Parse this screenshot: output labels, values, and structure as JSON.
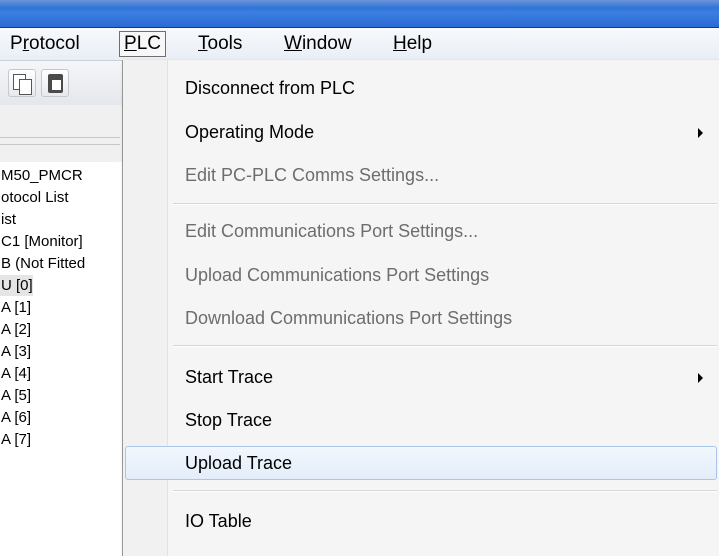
{
  "menubar": {
    "items": [
      {
        "label": "Protocol",
        "key": "r"
      },
      {
        "label": "PLC",
        "key": "P"
      },
      {
        "label": "Tools",
        "key": "T"
      },
      {
        "label": "Window",
        "key": "W"
      },
      {
        "label": "Help",
        "key": "H"
      }
    ]
  },
  "toolbar": {
    "buttons": [
      "copy-icon",
      "paste-icon"
    ]
  },
  "tree": {
    "items": [
      "M50_PMCR",
      "otocol List",
      "ist",
      "C1 [Monitor]",
      "B (Not Fitted",
      "U [0]",
      "A [1]",
      "A [2]",
      "A [3]",
      "A [4]",
      "A [5]",
      "A [6]",
      "A [7]"
    ]
  },
  "plc_menu": {
    "items": [
      {
        "label": "Disconnect from PLC",
        "enabled": true
      },
      {
        "label": "Operating Mode",
        "enabled": true,
        "submenu": true
      },
      {
        "label": "Edit PC-PLC Comms Settings...",
        "enabled": false
      },
      {
        "label": "Edit Communications Port Settings...",
        "enabled": false
      },
      {
        "label": "Upload Communications Port Settings",
        "enabled": false
      },
      {
        "label": "Download Communications Port Settings",
        "enabled": false
      },
      {
        "label": "Start Trace",
        "enabled": true,
        "submenu": true
      },
      {
        "label": "Stop Trace",
        "enabled": true
      },
      {
        "label": "Upload Trace",
        "enabled": true,
        "highlighted": true
      },
      {
        "label": "IO Table",
        "enabled": true
      }
    ]
  },
  "colors": {
    "titlebar": "#2c6ad4",
    "menu_background": "#f5f5f5",
    "disabled_text": "#6d6d6d",
    "highlight_border": "#a9c7e9"
  }
}
